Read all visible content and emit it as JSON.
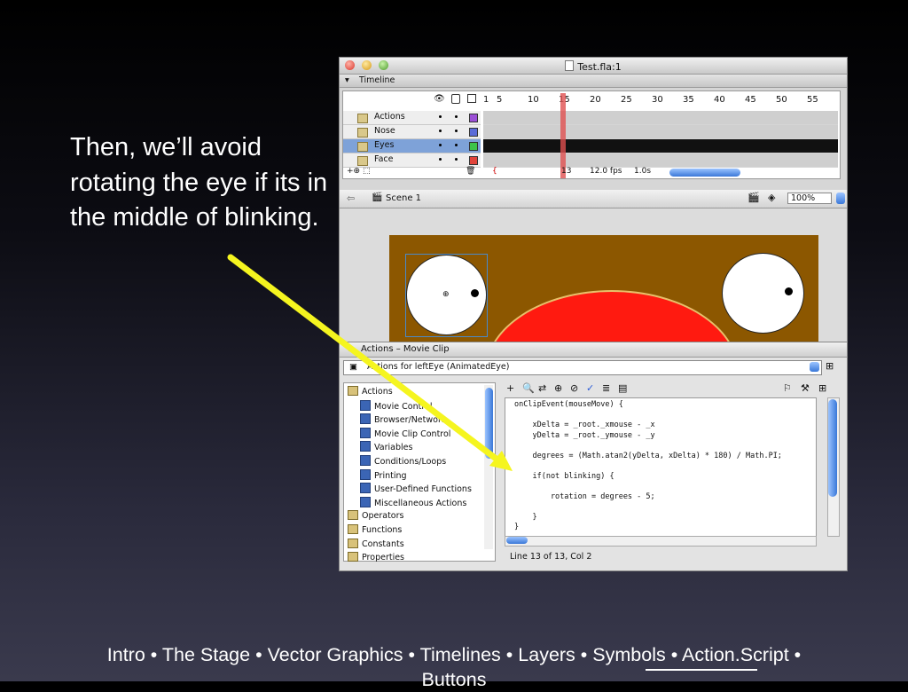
{
  "slide": {
    "text": "Then, we’ll avoid rotating the eye if its in the middle of blinking.",
    "footer_line1": "Intro • The Stage • Vector Graphics • Timelines • Layers • Symbols • Action.Script •",
    "footer_line2": "Buttons"
  },
  "window": {
    "title": "Test.fla:1"
  },
  "timeline": {
    "panel_label": "Timeline",
    "frame_numbers": [
      "1",
      "5",
      "10",
      "15",
      "20",
      "25",
      "30",
      "35",
      "40",
      "45",
      "50",
      "55"
    ],
    "layers": [
      {
        "name": "Actions",
        "color": "#9b4fd6",
        "selected": false
      },
      {
        "name": "Nose",
        "color": "#5a6bd8",
        "selected": false
      },
      {
        "name": "Eyes",
        "color": "#3ec44a",
        "selected": true
      },
      {
        "name": "Face",
        "color": "#e0443a",
        "selected": false
      }
    ],
    "status_frame": "13",
    "status_fps": "12.0 fps",
    "status_time": "1.0s"
  },
  "scene": {
    "label": "Scene 1",
    "zoom": "100%"
  },
  "actions_panel": {
    "title": "Actions – Movie Clip",
    "target": "Actions for leftEye (AnimatedEye)",
    "toolbox": [
      {
        "label": "Actions",
        "type": "book",
        "indent": 0
      },
      {
        "label": "Movie Control",
        "type": "item",
        "indent": 1
      },
      {
        "label": "Browser/Network",
        "type": "item",
        "indent": 1
      },
      {
        "label": "Movie Clip Control",
        "type": "item",
        "indent": 1
      },
      {
        "label": "Variables",
        "type": "item",
        "indent": 1
      },
      {
        "label": "Conditions/Loops",
        "type": "item",
        "indent": 1
      },
      {
        "label": "Printing",
        "type": "item",
        "indent": 1
      },
      {
        "label": "User-Defined Functions",
        "type": "item",
        "indent": 1
      },
      {
        "label": "Miscellaneous Actions",
        "type": "item",
        "indent": 1
      },
      {
        "label": "Operators",
        "type": "book",
        "indent": 0
      },
      {
        "label": "Functions",
        "type": "book",
        "indent": 0
      },
      {
        "label": "Constants",
        "type": "book",
        "indent": 0
      },
      {
        "label": "Properties",
        "type": "book",
        "indent": 0
      }
    ],
    "code": [
      "onClipEvent(mouseMove) {",
      "",
      "    xDelta = _root._xmouse - _x",
      "    yDelta = _root._ymouse - _y",
      "",
      "    degrees = (Math.atan2(yDelta, xDelta) * 180) / Math.PI;",
      "",
      "    if(not blinking) {",
      "",
      "        rotation = degrees - 5;",
      "",
      "    }",
      "}"
    ],
    "status": "Line 13 of 13, Col 2"
  }
}
